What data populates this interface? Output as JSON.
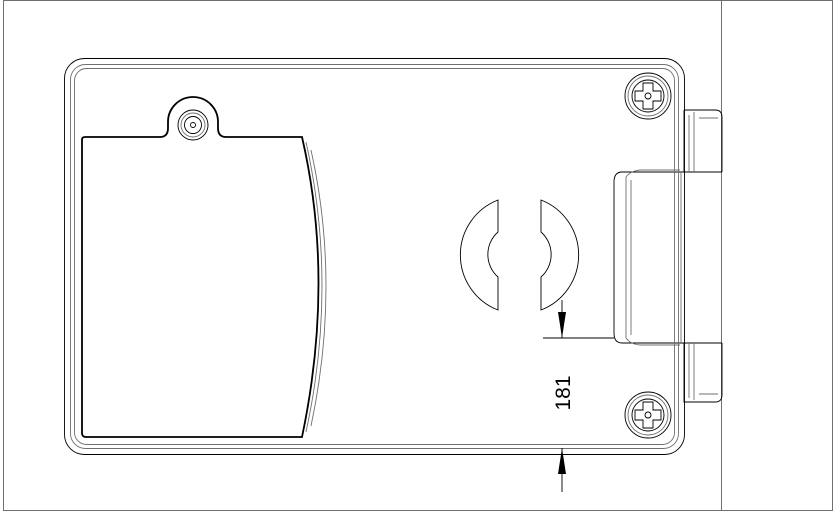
{
  "drawing": {
    "dimension_label": "181",
    "background": "#ffffff",
    "line_color": "#000000",
    "border_color": "#6f6f6f"
  },
  "icons": {
    "top_screw": "phillips-screw-icon",
    "bottom_screw": "phillips-screw-icon",
    "cover_screw": "torx-screw-icon"
  }
}
